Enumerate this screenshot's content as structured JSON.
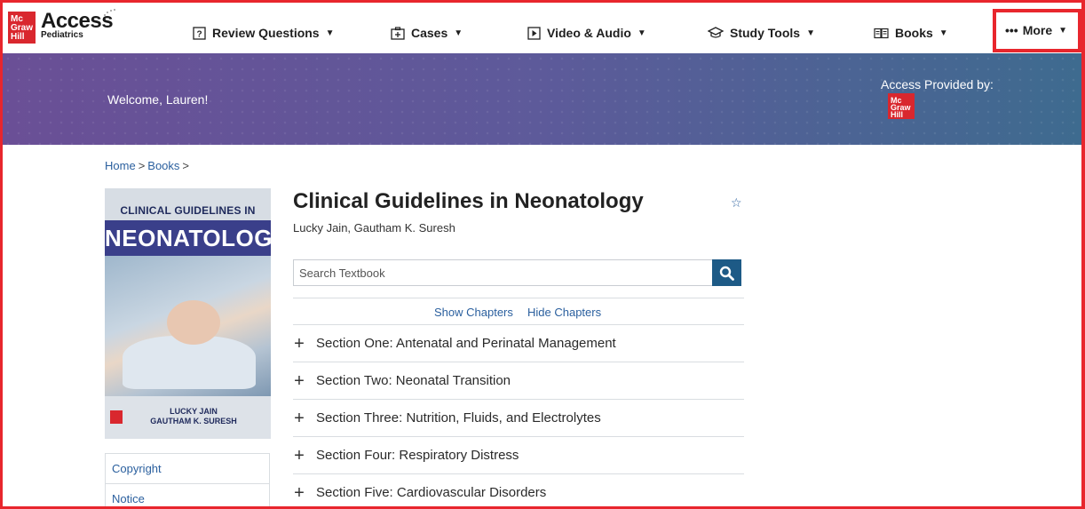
{
  "brand": {
    "badge": "Mc Graw Hill",
    "name": "Access",
    "sub": "Pediatrics"
  },
  "nav": {
    "items": [
      {
        "label": "Review Questions",
        "icon": "question-box-icon"
      },
      {
        "label": "Cases",
        "icon": "medical-case-icon"
      },
      {
        "label": "Video & Audio",
        "icon": "play-box-icon"
      },
      {
        "label": "Study Tools",
        "icon": "graduation-cap-icon"
      },
      {
        "label": "Books",
        "icon": "open-book-icon"
      }
    ],
    "more_label": "More",
    "more_icon": "ellipsis-icon",
    "highlight_color": "#e8262d"
  },
  "banner": {
    "welcome": "Welcome, Lauren!",
    "provided_by": "Access Provided by:",
    "provider_logo": "Mc Graw Hill"
  },
  "breadcrumb": {
    "home": "Home",
    "books": "Books",
    "separator": ">"
  },
  "book": {
    "title": "Clinical Guidelines in Neonatology",
    "authors": "Lucky Jain, Gautham K. Suresh",
    "cover": {
      "line1": "CLINICAL GUIDELINES IN",
      "line2": "NEONATOLOGY",
      "author1": "LUCKY JAIN",
      "author2": "GAUTHAM K. SURESH"
    }
  },
  "search": {
    "placeholder": "Search Textbook",
    "value": ""
  },
  "chapters": {
    "show_label": "Show Chapters",
    "hide_label": "Hide Chapters"
  },
  "sections": [
    "Section One: Antenatal and Perinatal Management",
    "Section Two: Neonatal Transition",
    "Section Three: Nutrition, Fluids, and Electrolytes",
    "Section Four: Respiratory Distress",
    "Section Five: Cardiovascular Disorders"
  ],
  "side_links": [
    "Copyright",
    "Notice"
  ],
  "colors": {
    "link": "#2a5f9e",
    "search_button": "#1d5a86",
    "brand_red": "#d9272e"
  }
}
